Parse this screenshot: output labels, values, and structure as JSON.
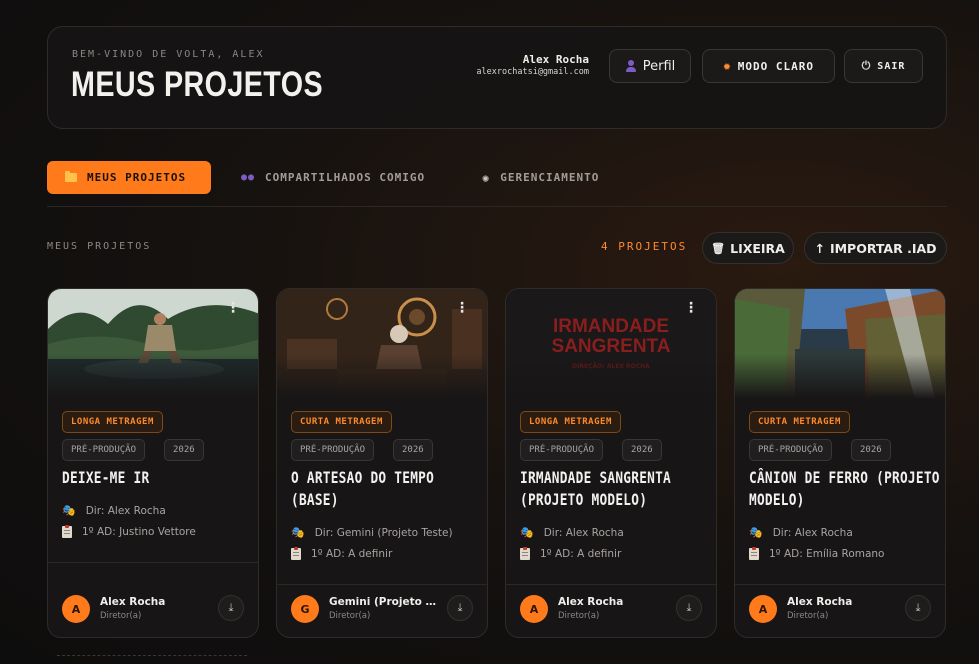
{
  "header": {
    "welcome": "BEM-VINDO DE VOLTA, ALEX",
    "title": "MEUS PROJETOS",
    "user_name": "Alex Rocha",
    "user_email": "alexrochatsi@gmail.com",
    "profile_label": "Perfil",
    "light_mode_label": "MODO CLARO",
    "exit_label": "SAIR"
  },
  "tabs": [
    {
      "label": "MEUS PROJETOS",
      "active": true
    },
    {
      "label": "COMPARTILHADOS COMIGO",
      "active": false
    },
    {
      "label": "GERENCIAMENTO",
      "active": false
    }
  ],
  "toolbar": {
    "section_label": "MEUS PROJETOS",
    "count": "4 PROJETOS",
    "trash_label": "LIXEIRA",
    "import_label": "IMPORTAR .IAD"
  },
  "projects": [
    {
      "genre": "LONGA METRAGEM",
      "stage": "PRÉ-PRODUÇÃO",
      "year": "2026",
      "title": "DEIXE-ME IR",
      "director": "Dir: Alex Rocha",
      "ad": "1º AD: Justino Vettore",
      "owner_initial": "A",
      "owner_name": "Alex Rocha",
      "owner_role": "Diretor(a)"
    },
    {
      "genre": "CURTA METRAGEM",
      "stage": "PRÉ-PRODUÇÃO",
      "year": "2026",
      "title": "O ARTESAO DO TEMPO (BASE)",
      "director": "Dir: Gemini (Projeto Teste)",
      "ad": "1º AD: A definir",
      "owner_initial": "G",
      "owner_name": "Gemini (Projeto Te...",
      "owner_role": "Diretor(a)"
    },
    {
      "genre": "LONGA METRAGEM",
      "stage": "PRÉ-PRODUÇÃO",
      "year": "2026",
      "title": "IRMANDADE SANGRENTA (PROJETO MODELO)",
      "poster_title": "IRMANDADE SANGRENTA",
      "poster_credit": "DIREÇÃO: ALEX ROCHA",
      "director": "Dir: Alex Rocha",
      "ad": "1º AD: A definir",
      "owner_initial": "A",
      "owner_name": "Alex Rocha",
      "owner_role": "Diretor(a)"
    },
    {
      "genre": "CURTA METRAGEM",
      "stage": "PRÉ-PRODUÇÃO",
      "year": "2026",
      "title": "CÂNION DE FERRO (PROJETO MODELO)",
      "director": "Dir: Alex Rocha",
      "ad": "1º AD: Emília Romano",
      "owner_initial": "A",
      "owner_name": "Alex Rocha",
      "owner_role": "Diretor(a)"
    }
  ],
  "colors": {
    "accent": "#ff7a1a",
    "background": "#14110f",
    "card": "#171516"
  }
}
